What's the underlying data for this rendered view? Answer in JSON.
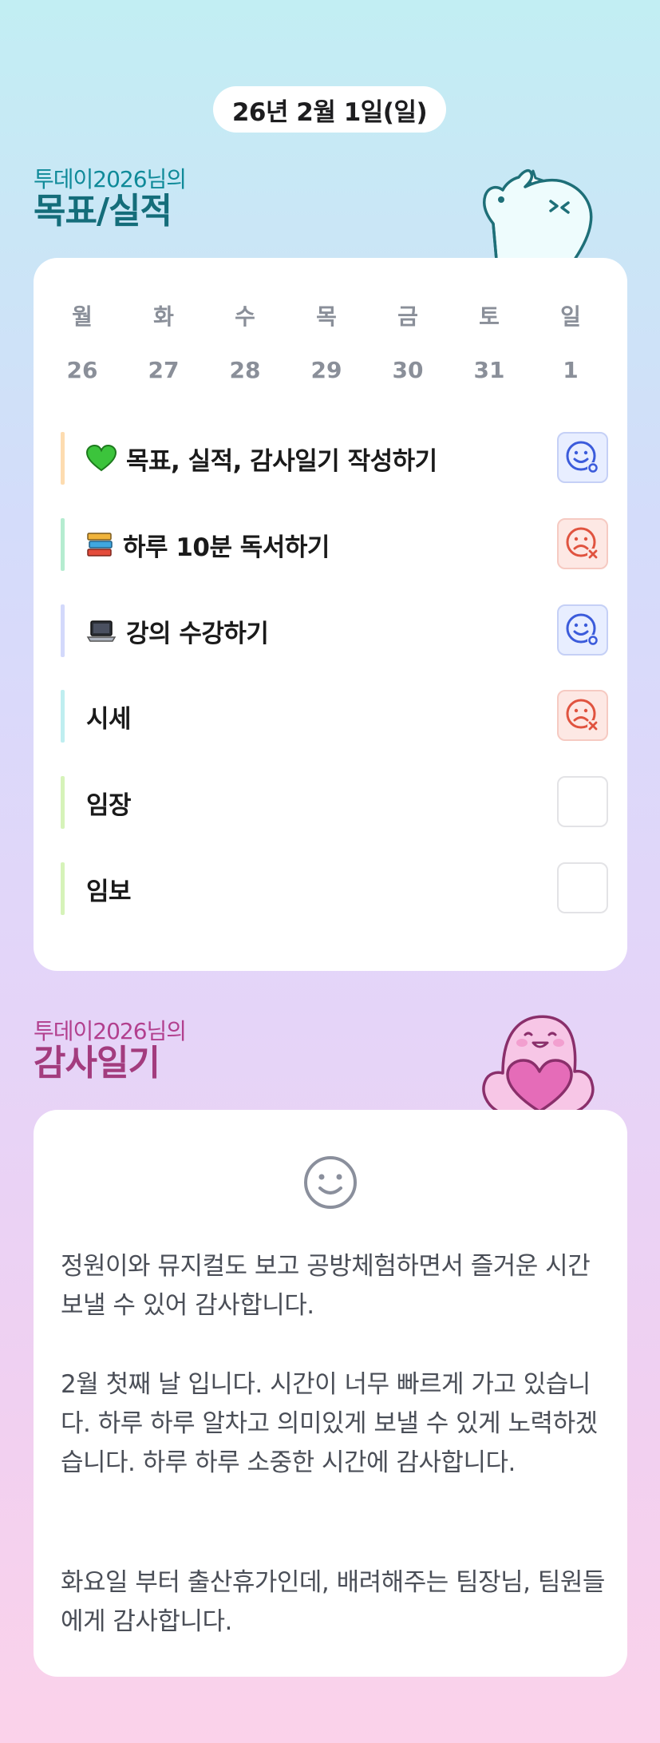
{
  "header": {
    "date": "26년 2월 1일(일)"
  },
  "goals_section": {
    "subtitle": "투데이2026님의",
    "title": "목표/실적",
    "weekdays": [
      "월",
      "화",
      "수",
      "목",
      "금",
      "토",
      "일"
    ],
    "days": [
      "26",
      "27",
      "28",
      "29",
      "30",
      "31",
      "1"
    ],
    "goals": [
      {
        "label": "목표, 실적, 감사일기 작성하기",
        "icon": "green-heart-icon",
        "bar_color": "#fddcb0",
        "status": "success"
      },
      {
        "label": "하루 10분 독서하기",
        "icon": "books-icon",
        "bar_color": "#b5ecd0",
        "status": "fail"
      },
      {
        "label": "강의 수강하기",
        "icon": "laptop-icon",
        "bar_color": "#d3d9fb",
        "status": "success"
      },
      {
        "label": "시세",
        "icon": "",
        "bar_color": "#bfeef0",
        "status": "fail"
      },
      {
        "label": "임장",
        "icon": "",
        "bar_color": "#d6f3b9",
        "status": "empty"
      },
      {
        "label": "임보",
        "icon": "",
        "bar_color": "#d6f3b9",
        "status": "empty"
      }
    ]
  },
  "gratitude_section": {
    "subtitle": "투데이2026님의",
    "title": "감사일기",
    "icon": "smile-icon",
    "paragraphs": [
      "정원이와 뮤지컬도 보고 공방체험하면서 즐거운 시간 보낼 수 있어 감사합니다.",
      "2월 첫째 날 입니다. 시간이 너무 빠르게 가고 있습니다. 하루 하루 알차고 의미있게 보낼 수 있게 노력하겠습니다. 하루 하루 소중한 시간에 감사합니다.",
      "화요일 부터 출산휴가인데, 배려해주는 팀장님, 팀원들에게 감사합니다."
    ]
  },
  "colors": {
    "success": "#3b5bdb",
    "fail": "#e0533f",
    "teal_title": "#146d7a",
    "pink_title": "#a33c7e"
  }
}
